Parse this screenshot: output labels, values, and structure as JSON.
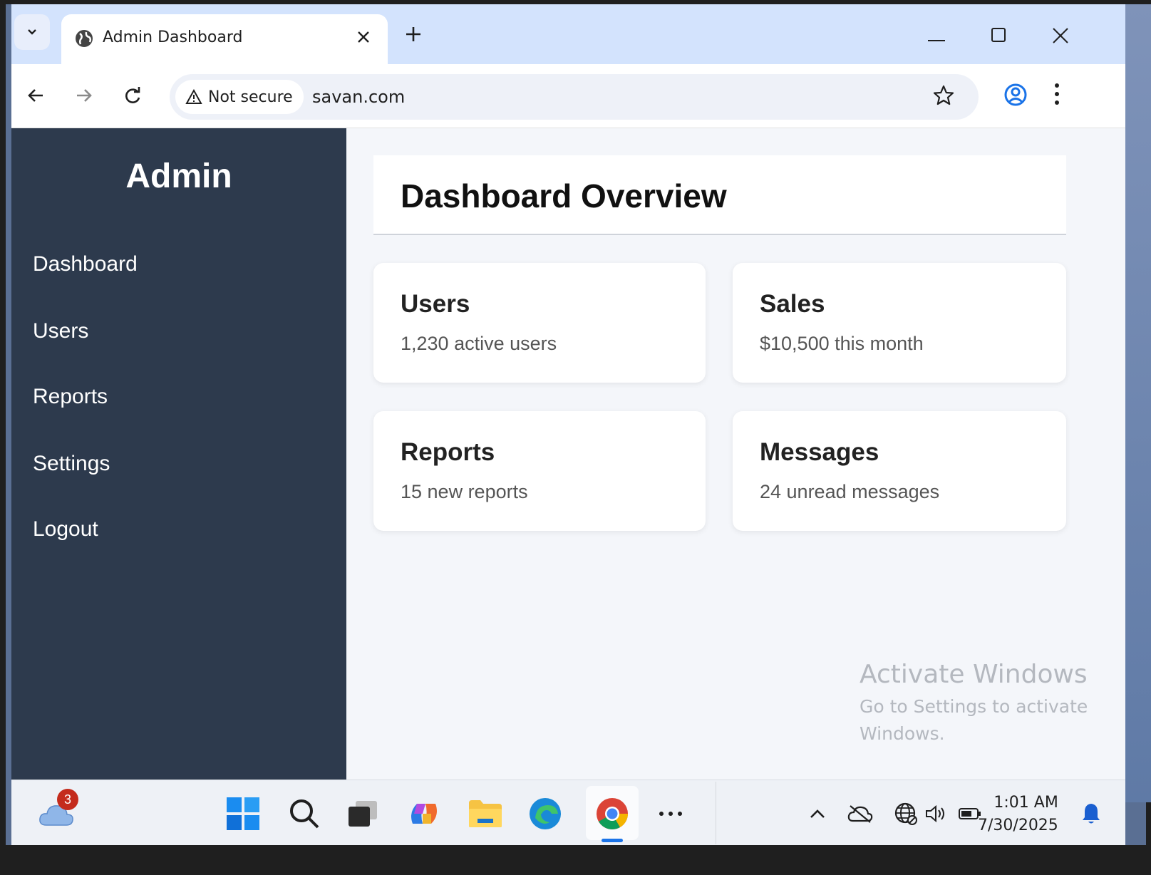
{
  "browser": {
    "tab_title": "Admin Dashboard",
    "security_label": "Not secure",
    "url": "savan.com"
  },
  "sidebar": {
    "title": "Admin",
    "items": [
      {
        "label": "Dashboard"
      },
      {
        "label": "Users"
      },
      {
        "label": "Reports"
      },
      {
        "label": "Settings"
      },
      {
        "label": "Logout"
      }
    ]
  },
  "main": {
    "title": "Dashboard Overview",
    "cards": [
      {
        "label": "Users",
        "value": "1,230 active users"
      },
      {
        "label": "Sales",
        "value": "$10,500 this month"
      },
      {
        "label": "Reports",
        "value": "15 new reports"
      },
      {
        "label": "Messages",
        "value": "24 unread messages"
      }
    ]
  },
  "watermark": {
    "heading": "Activate Windows",
    "subtext": "Go to Settings to activate Windows."
  },
  "taskbar": {
    "weather_badge": "3",
    "time": "1:01 AM",
    "date": "7/30/2025"
  },
  "colors": {
    "sidebar_bg": "#2d3a4d",
    "main_bg": "#f4f6fa",
    "accent": "#1a73e8"
  }
}
